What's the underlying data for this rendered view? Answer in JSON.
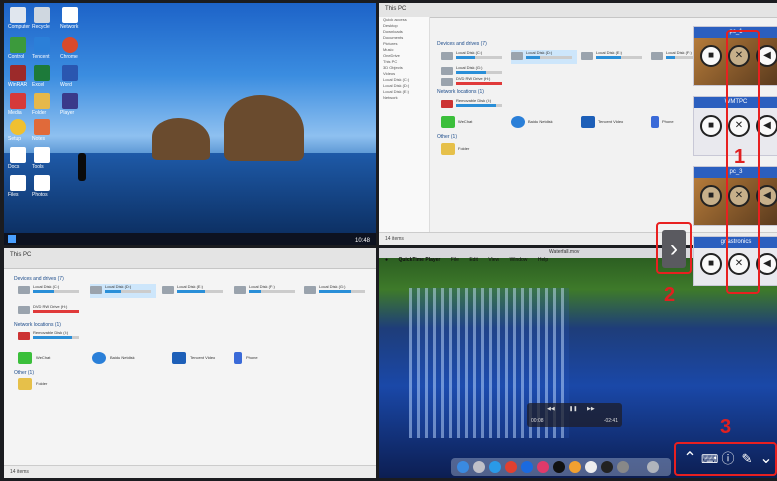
{
  "screen_top_left": {
    "desktop_labels": [
      "Computer",
      "Recycle",
      "Network",
      "Control",
      "Tencent",
      "Chrome",
      "WinRAR",
      "Excel",
      "Word",
      "Media",
      "Folder",
      "Player",
      "Setup",
      "Notes",
      "Docs",
      "Tools",
      "Files",
      "Photos"
    ],
    "taskbar_time": "10:48"
  },
  "screen_top_right": {
    "window_title": "This PC",
    "section_devices": "Devices and drives (7)",
    "section_network": "Network locations (1)",
    "section_other": "Other (1)",
    "drives": [
      {
        "name": "Local Disk (C:)",
        "used": 0.42
      },
      {
        "name": "Local Disk (D:)",
        "used": 0.3
      },
      {
        "name": "Local Disk (E:)",
        "used": 0.55
      },
      {
        "name": "Local Disk (F:)",
        "used": 0.2
      },
      {
        "name": "Local Disk (G:)",
        "used": 0.65
      },
      {
        "name": "DVD RW Drive (H:)",
        "used": 0.0
      },
      {
        "name": "Removable Disk (I:)",
        "used": 0.88
      }
    ],
    "apps": [
      "WeChat",
      "Baidu Netdisk",
      "Tencent Video",
      "Phone",
      "Folder"
    ],
    "tree_items": [
      "Quick access",
      "Desktop",
      "Downloads",
      "Documents",
      "Pictures",
      "Music",
      "OneDrive",
      "This PC",
      "3D Objects",
      "Videos",
      "Local Disk (C:)",
      "Local Disk (D:)",
      "Local Disk (E:)",
      "Network"
    ],
    "status": "14 items"
  },
  "screen_bottom_left": {
    "window_title": "This PC",
    "section_devices": "Devices and drives (7)",
    "section_network": "Network locations (1)",
    "section_other": "Other (1)",
    "drives": [
      {
        "name": "Local Disk (C:)",
        "used": 0.45
      },
      {
        "name": "Local Disk (D:)",
        "used": 0.35
      },
      {
        "name": "Local Disk (E:)",
        "used": 0.6
      },
      {
        "name": "Local Disk (F:)",
        "used": 0.25
      },
      {
        "name": "Local Disk (G:)",
        "used": 0.7
      },
      {
        "name": "DVD RW Drive (H:)",
        "used": 0.0
      },
      {
        "name": "Removable Disk (I:)",
        "used": 0.85
      }
    ],
    "apps": [
      "WeChat",
      "Baidu Netdisk",
      "Tencent Video",
      "Phone",
      "Folder"
    ],
    "status": "14 items"
  },
  "screen_bottom_right": {
    "menu_items": [
      "QuickTime Player",
      "File",
      "Edit",
      "View",
      "Window",
      "Help"
    ],
    "player_title": "Waterfall.mov",
    "player_time_elapsed": "00:08",
    "player_time_remaining": "-02:41"
  },
  "control_panel": {
    "cards": [
      {
        "title": "pc_1"
      },
      {
        "title": "WMTPC"
      },
      {
        "title": "pc_3"
      },
      {
        "title": "gnastronics"
      }
    ]
  },
  "expand_icon": "chevron-right",
  "system_bar_icons": [
    "chevron-up-icon",
    "keyboard-icon",
    "info-icon",
    "pen-icon",
    "chevron-down-icon"
  ],
  "callouts": [
    "1",
    "2",
    "3"
  ],
  "colors": {
    "callout_red": "#e82020",
    "card_header_blue": "#2b5fbf",
    "drive_bar_blue": "#2a8fd8"
  }
}
